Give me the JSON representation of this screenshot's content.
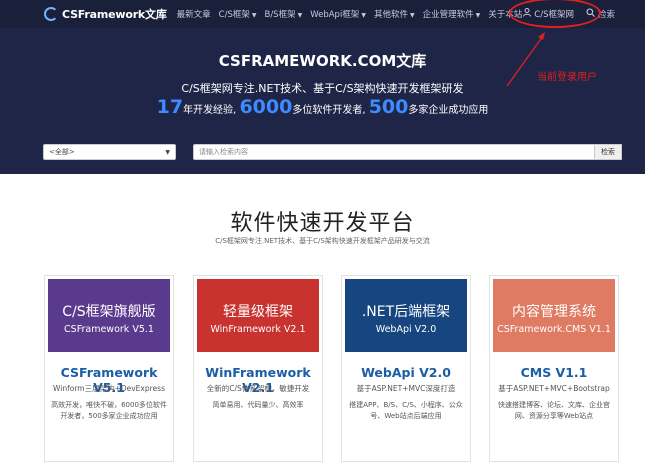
{
  "nav": {
    "brand": "CSFramework文库",
    "items": [
      {
        "label": "最新文章",
        "caret": false
      },
      {
        "label": "C/S框架",
        "caret": true
      },
      {
        "label": "B/S框架",
        "caret": true
      },
      {
        "label": "WebApi框架",
        "caret": true
      },
      {
        "label": "其他软件",
        "caret": true
      },
      {
        "label": "企业管理软件",
        "caret": true
      },
      {
        "label": "关于本站",
        "caret": false
      }
    ],
    "user": "C/S框架网",
    "search": "检索"
  },
  "hero": {
    "title": "CSFRAMEWORK.COM文库",
    "subtitle": "C/S框架网专注.NET技术、基于C/S架构快速开发框架研发",
    "stat1_num": "17",
    "stat1_text": "年开发经验,",
    "stat2_num": "6000",
    "stat2_text": "多位软件开发者,",
    "stat3_num": "500",
    "stat3_text": "多家企业成功应用"
  },
  "annotation": "当前登录用户",
  "search": {
    "category": "<全部>",
    "placeholder": "请输入检索内容",
    "button": "检索"
  },
  "section": {
    "title": "软件快速开发平台",
    "subtitle": "C/S框架网专注.NET技术、基于C/S架构快速开发框架产品研发与交流"
  },
  "cards": [
    {
      "banner_title": "C/S框架旗舰版",
      "banner_sub": "CSFramework V5.1",
      "name": "CSFramework V5.1",
      "desc": "Winform三层架构+DevExpress",
      "detail": "高效开发，唯快不破，6000多位软件开发者，500多家企业成功应用",
      "color": "#5a3a8c"
    },
    {
      "banner_title": "轻量级框架",
      "banner_sub": "WinFramework V2.1",
      "name": "WinFramework V2.1",
      "desc": "全新的C/S体系架构，敏捷开发",
      "detail": "简单易用、代码量少、高效率",
      "color": "#c8332f"
    },
    {
      "banner_title": ".NET后端框架",
      "banner_sub": "WebApi V2.0",
      "name": "WebApi V2.0",
      "desc": "基于ASP.NET+MVC深度打造",
      "detail": "搭建APP、B/S、C/S、小程序、公众号、Web站点后端应用",
      "color": "#17457f"
    },
    {
      "banner_title": "内容管理系统",
      "banner_sub": "CSFramework.CMS V1.1",
      "name": "CMS V1.1",
      "desc": "基于ASP.NET+MVC+Bootstrap",
      "detail": "快速搭建博客、论坛、文库、企业官网、资源分享等Web站点",
      "color": "#e07b63"
    }
  ]
}
